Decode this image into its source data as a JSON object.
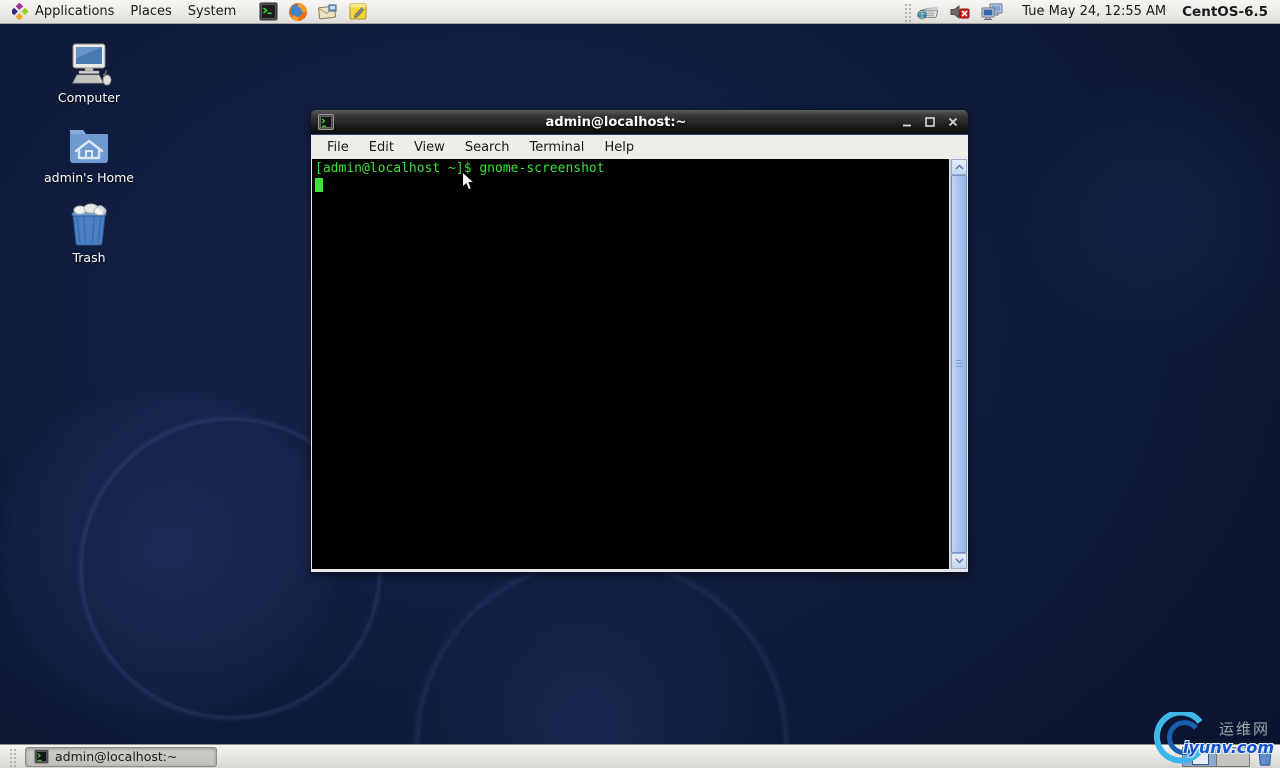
{
  "colors": {
    "terminal_green": "#3be13b",
    "panel_bg": "#e6e4e0",
    "desktop_base": "#0d1734",
    "scrollbar_blue": "#a4bfe9",
    "watermark_blue": "#1254c8"
  },
  "top_panel": {
    "menus": [
      {
        "label": "Applications"
      },
      {
        "label": "Places"
      },
      {
        "label": "System"
      }
    ],
    "clock": "Tue May 24, 12:55 AM",
    "distro_label": "CentOS-6.5"
  },
  "desktop_icons": [
    {
      "label": "Computer"
    },
    {
      "label": "admin's Home"
    },
    {
      "label": "Trash"
    }
  ],
  "terminal_window": {
    "title": "admin@localhost:~",
    "menu_items": [
      "File",
      "Edit",
      "View",
      "Search",
      "Terminal",
      "Help"
    ],
    "prompt_line": "[admin@localhost ~]$ gnome-screenshot"
  },
  "taskbar": {
    "task_button_label": "admin@localhost:~"
  },
  "watermark": {
    "site_name": "运维网",
    "site_domain": "iyunv.com"
  }
}
